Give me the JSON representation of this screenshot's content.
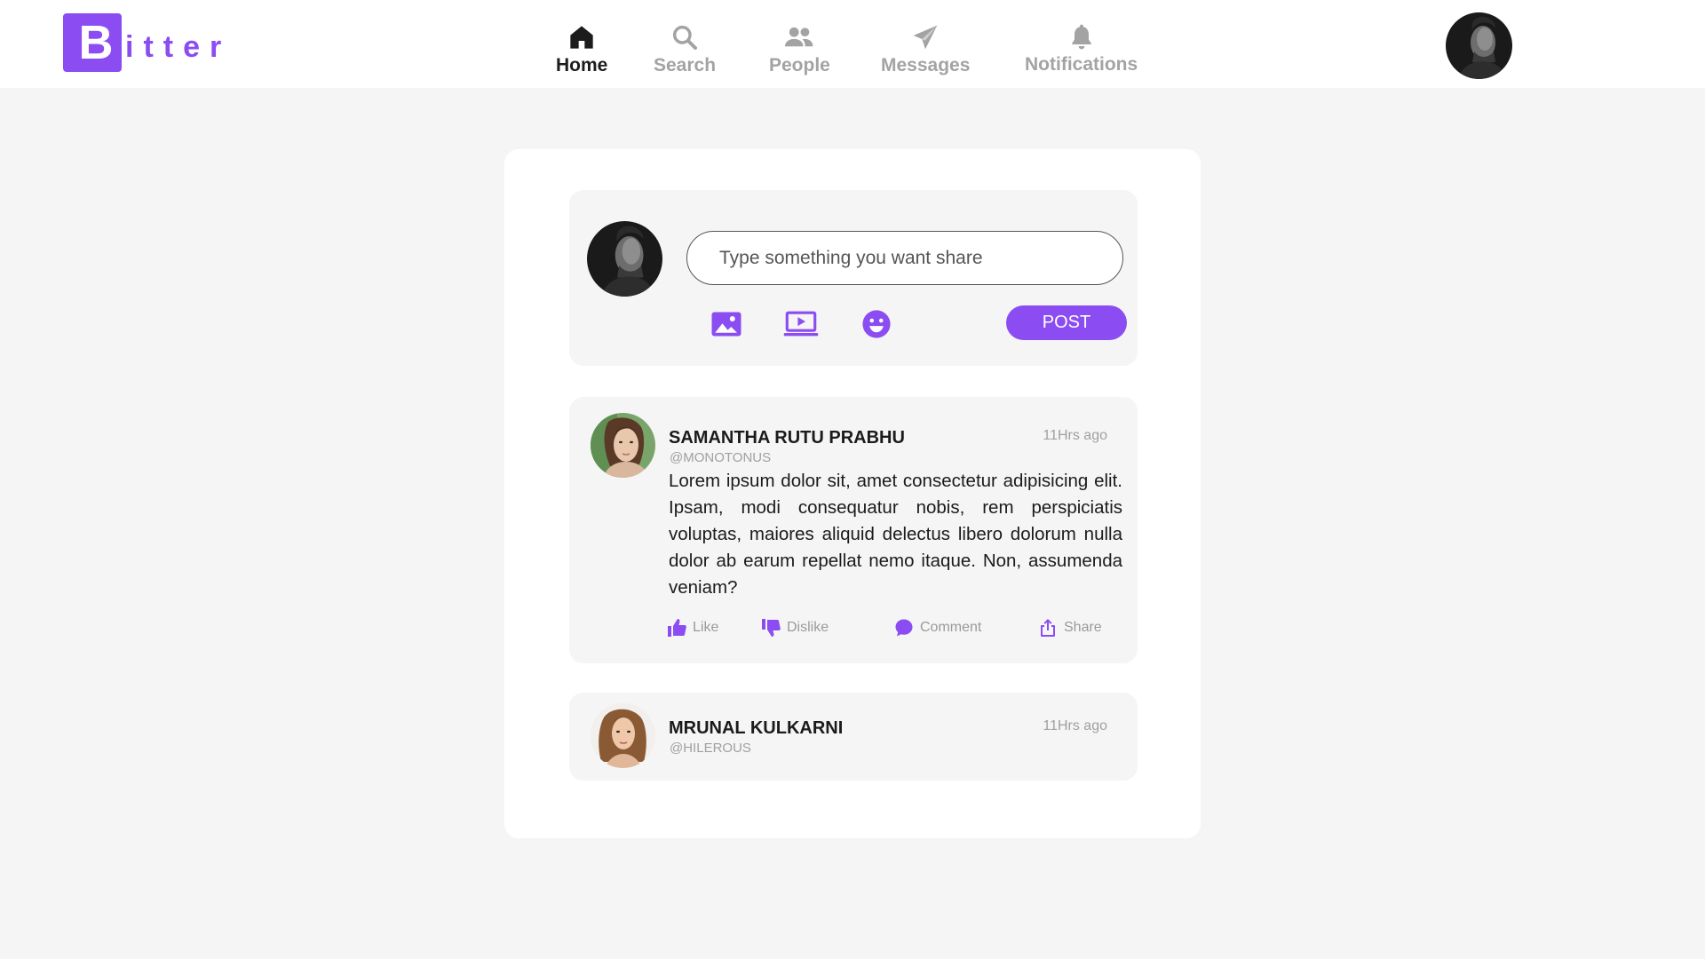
{
  "brand": {
    "logo_letter": "B",
    "logo_rest": "itter",
    "accent_color": "#8b4df2"
  },
  "nav": {
    "items": [
      {
        "label": "Home",
        "icon": "home-icon",
        "active": true
      },
      {
        "label": "Search",
        "icon": "search-icon",
        "active": false
      },
      {
        "label": "People",
        "icon": "people-icon",
        "active": false
      },
      {
        "label": "Messages",
        "icon": "send-icon",
        "active": false
      },
      {
        "label": "Notifications",
        "icon": "bell-icon",
        "active": false
      }
    ]
  },
  "composer": {
    "placeholder": "Type something you want share",
    "tools": [
      "image-icon",
      "video-icon",
      "emoji-icon"
    ],
    "post_label": "POST"
  },
  "posts": [
    {
      "name": "SAMANTHA RUTU PRABHU",
      "handle": "@MONOTONUS",
      "time": "11Hrs ago",
      "text": "Lorem ipsum dolor sit, amet consectetur adipisicing elit. Ipsam, modi consequatur nobis, rem perspiciatis voluptas, maiores aliquid delectus libero dolorum nulla dolor ab earum repellat nemo itaque. Non, assumenda veniam?",
      "actions": {
        "like": "Like",
        "dislike": "Dislike",
        "comment": "Comment",
        "share": "Share"
      }
    },
    {
      "name": "MRUNAL KULKARNI",
      "handle": "@HILEROUS",
      "time": "11Hrs ago"
    }
  ]
}
